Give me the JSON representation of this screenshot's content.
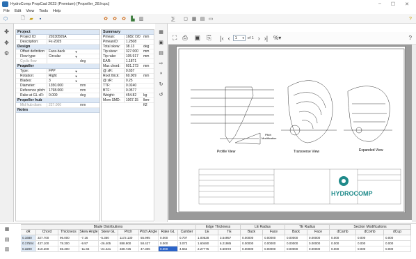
{
  "window": {
    "title": "HydroComp PropCad 2023 (Premium)  [Propeller_28.hcpc]",
    "controls": [
      "–",
      "☐",
      "✕"
    ]
  },
  "menu": [
    "File",
    "Edit",
    "View",
    "Tools",
    "Help"
  ],
  "project": {
    "header": "Project",
    "rows": [
      {
        "label": "Project ID:",
        "value": "20230505A"
      },
      {
        "label": "Description:",
        "value": "Fx-2025"
      }
    ]
  },
  "design": {
    "header": "Design",
    "rows": [
      {
        "label": "Offset definition:",
        "value": "Face-back",
        "dropdown": true
      },
      {
        "label": "Flow type:",
        "value": "Circular",
        "dropdown": true
      },
      {
        "label": "Cyclic flow angle:",
        "value": "",
        "unit": "deg",
        "grey": true
      }
    ]
  },
  "propeller": {
    "header": "Propeller",
    "rows": [
      {
        "label": "Type:",
        "value": "FPP",
        "dropdown": true
      },
      {
        "label": "Rotation:",
        "value": "Right",
        "dropdown": true
      },
      {
        "label": "Blades:",
        "value": "3",
        "dropdown": true
      },
      {
        "label": "Diameter:",
        "value": "1350.000",
        "unit": "mm"
      },
      {
        "label": "Reference pitch:",
        "value": "1798.000",
        "unit": "mm"
      },
      {
        "label": "Rake at GL xR:",
        "value": "0.000",
        "unit": "deg"
      }
    ]
  },
  "propeller_hub": {
    "header": "Propeller hub",
    "rows": [
      {
        "label": "Mid hub diam:",
        "value": "227.000",
        "unit": "mm",
        "grey": true
      }
    ]
  },
  "notes": {
    "header": "Notes"
  },
  "summary": {
    "header": "Summary",
    "rows": [
      {
        "label": "Pmean:",
        "value": "1682.720",
        "unit": "mm"
      },
      {
        "label": "Pmean/D:",
        "value": "1.2508",
        "unit": ""
      },
      {
        "label": "Total skew:",
        "value": "38.13",
        "unit": "deg"
      },
      {
        "label": "Tip skew:",
        "value": "327.000",
        "unit": "mm"
      },
      {
        "label": "Tip rake:",
        "value": "105.917",
        "unit": "mm"
      },
      {
        "label": "EAR:",
        "value": "1.1871",
        "unit": ""
      },
      {
        "label": "Max chord:",
        "value": "601.273",
        "unit": "mm"
      },
      {
        "label": "@ xR:",
        "value": "0.657",
        "unit": ""
      },
      {
        "label": "Root thick:",
        "value": "69.009",
        "unit": "mm"
      },
      {
        "label": "@ xR:",
        "value": "0.25",
        "unit": ""
      },
      {
        "label": "TTF:",
        "value": "0.0240",
        "unit": ""
      },
      {
        "label": "BTF:",
        "value": "0.0577",
        "unit": ""
      },
      {
        "label": "Weight:",
        "value": "454.82",
        "unit": "kg"
      },
      {
        "label": "Mom SMD:",
        "value": "1067.15",
        "unit": "lbm-ft2"
      }
    ]
  },
  "pdf": {
    "page_input": "1",
    "page_total": "of 1",
    "zoom": "%",
    "drawing_labels": {
      "profile": "Profile View",
      "transverse": "Transverse View",
      "expanded": "Expanded View",
      "pitch": "Pitch",
      "pitch2": "Modification",
      "brand": "HYDROCOMP"
    }
  },
  "grid": {
    "groups": [
      {
        "label": "Blade Distributions",
        "span": 10
      },
      {
        "label": "Edge Thickness",
        "span": 2
      },
      {
        "label": "LE Radius",
        "span": 2
      },
      {
        "label": "TE Radius",
        "span": 2
      },
      {
        "label": "Section Modifications",
        "span": 3
      }
    ],
    "columns": [
      "xR",
      "Chord",
      "Thickness",
      "Skew Angle",
      "Skew GL",
      "Pitch",
      "Pitch Angle",
      "Rake GL",
      "Camber",
      "LE",
      "TE",
      "Back",
      "Face",
      "Back",
      "Face",
      "dCamb",
      "dComb",
      "dCup"
    ],
    "rows": [
      [
        "0.1680",
        "327.700",
        "96.000",
        "-7.16",
        "-5.360",
        "1172.130",
        "55.995",
        "0.000",
        "0.707",
        "1.00528",
        "3.54957",
        "0.00000",
        "0.00000",
        "0.00000",
        "0.00000",
        "0.000",
        "0.000",
        "0.000"
      ],
      [
        "0.17504",
        "437.100",
        "78.300",
        "-9.97",
        "-26.405",
        "888.900",
        "58.427",
        "0.000",
        "3.072",
        "1.60480",
        "6.21985",
        "0.00000",
        "0.00000",
        "0.00000",
        "0.00000",
        "0.000",
        "0.000",
        "0.000"
      ],
      [
        "0.3200",
        "410.200",
        "55.300",
        "-11.66",
        "-24.421",
        "338.725",
        "47.306",
        "0.000",
        "4.662",
        "2.27775",
        "6.60072",
        "0.00000",
        "0.00000",
        "0.00000",
        "0.00000",
        "0.000",
        "0.000",
        "0.000"
      ]
    ]
  }
}
